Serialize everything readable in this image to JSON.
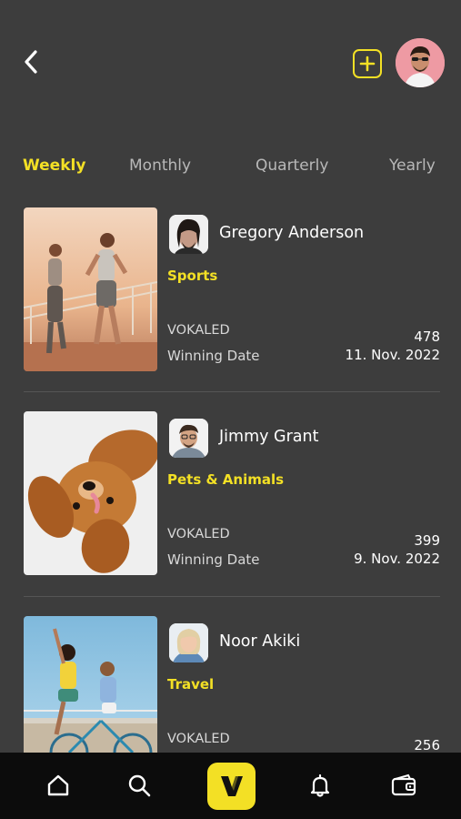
{
  "header": {
    "back_icon": "chevron-left-icon",
    "add_icon": "plus-square-icon",
    "accent": "#f3e025"
  },
  "tabs": [
    {
      "label": "Weekly",
      "active": true
    },
    {
      "label": "Monthly",
      "active": false
    },
    {
      "label": "Quarterly",
      "active": false
    },
    {
      "label": "Yearly",
      "active": false
    }
  ],
  "entries": [
    {
      "name": "Gregory Anderson",
      "category": "Sports",
      "vokaled_label": "VOKALED",
      "count": "478",
      "date_label": "Winning Date",
      "date": "11. Nov. 2022"
    },
    {
      "name": "Jimmy Grant",
      "category": "Pets & Animals",
      "vokaled_label": "VOKALED",
      "count": "399",
      "date_label": "Winning Date",
      "date": "9. Nov. 2022"
    },
    {
      "name": "Noor Akiki",
      "category": "Travel",
      "vokaled_label": "VOKALED",
      "count": "256"
    }
  ],
  "bottom_nav": {
    "items": [
      "home-icon",
      "search-icon",
      "vokal-logo",
      "bell-icon",
      "wallet-icon"
    ],
    "logo_letter": "V"
  }
}
